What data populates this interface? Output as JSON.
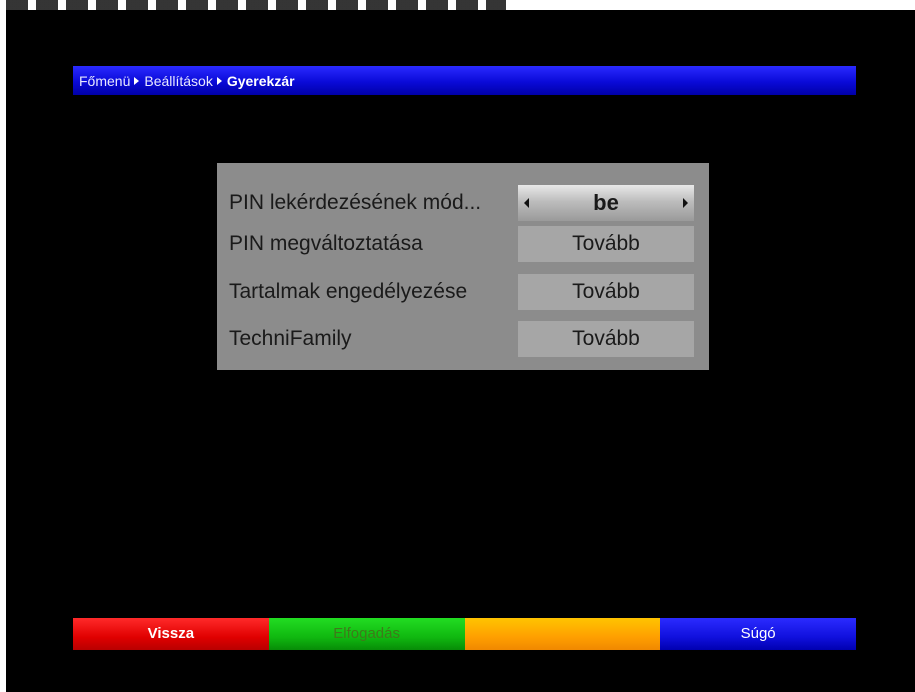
{
  "breadcrumb": {
    "items": [
      "Főmenü",
      "Beállítások",
      "Gyerekzár"
    ]
  },
  "menu": {
    "rows": [
      {
        "label": "PIN lekérdezésének mód...",
        "value": "be"
      },
      {
        "label": "PIN megváltoztatása",
        "value": "Tovább"
      },
      {
        "label": "Tartalmak engedélyezése",
        "value": "Tovább"
      },
      {
        "label": "TechniFamily",
        "value": "Tovább"
      }
    ]
  },
  "footer": {
    "red_label": "Vissza",
    "green_label": "Elfogadás",
    "yellow_label": "",
    "blue_label": "Súgó"
  },
  "colors": {
    "breadcrumb_bar": "#0a0ad8",
    "dialog_bg": "#8c8c8c",
    "value_bg": "#a6a6a6",
    "key_red": "#e00000",
    "key_green": "#10b810",
    "key_yellow": "#ff9f00",
    "key_blue": "#1010dd"
  }
}
